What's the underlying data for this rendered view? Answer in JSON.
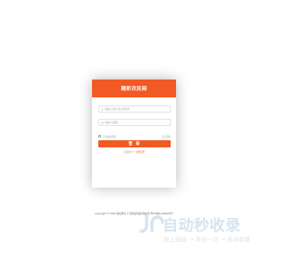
{
  "login": {
    "title": "精彩农民网",
    "username_placeholder": "请输入用户名/手机号",
    "password_placeholder": "请输入密码",
    "remember_label": "下次自动登录",
    "forgot_label": "忘记密码",
    "submit_label": "登 录",
    "register_prompt": "还没账号？",
    "register_link": "立即注册"
  },
  "footer": {
    "copyright": "Copyright © 2023 版权所有 广东腾龙科技有限公司 粤ICP备12345678号"
  },
  "watermark": {
    "title": "自动秒收录",
    "subtitle": "放上链接 → 来访一次 → 自动收录"
  },
  "colors": {
    "accent": "#f15a24",
    "watermark": "#8cb3d6"
  },
  "icons": [
    "user-icon",
    "lock-icon"
  ]
}
